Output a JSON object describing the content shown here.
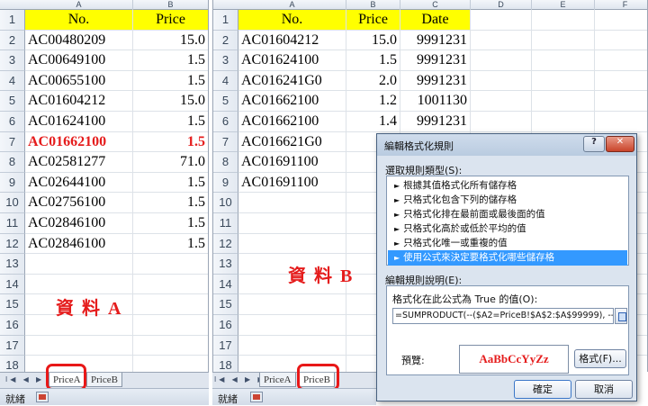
{
  "sheet_a": {
    "col_letters": [
      "A",
      "B",
      "C"
    ],
    "header": [
      "No.",
      "Price"
    ],
    "rows": [
      {
        "no": "AC00480209",
        "price": "15.0"
      },
      {
        "no": "AC00649100",
        "price": "1.5"
      },
      {
        "no": "AC00655100",
        "price": "1.5"
      },
      {
        "no": "AC01604212",
        "price": "15.0"
      },
      {
        "no": "AC01624100",
        "price": "1.5"
      },
      {
        "no": "AC01662100",
        "price": "1.5",
        "highlight": true
      },
      {
        "no": "AC02581277",
        "price": "71.0"
      },
      {
        "no": "AC02644100",
        "price": "1.5"
      },
      {
        "no": "AC02756100",
        "price": "1.5"
      },
      {
        "no": "AC02846100",
        "price": "1.5"
      },
      {
        "no": "AC02846100",
        "price": "1.5"
      }
    ],
    "caption": "資 料 A",
    "tabs": [
      "PriceA",
      "PriceB"
    ],
    "tab_nav": "I◀ ◀ ▶ ▶I",
    "status": "就緒"
  },
  "sheet_b": {
    "col_letters": [
      "A",
      "B",
      "C",
      "D",
      "E",
      "F"
    ],
    "header": [
      "No.",
      "Price",
      "Date"
    ],
    "rows": [
      {
        "no": "AC01604212",
        "price": "15.0",
        "date": "9991231"
      },
      {
        "no": "AC01624100",
        "price": "1.5",
        "date": "9991231"
      },
      {
        "no": "AC016241G0",
        "price": "2.0",
        "date": "9991231"
      },
      {
        "no": "AC01662100",
        "price": "1.2",
        "date": "1001130"
      },
      {
        "no": "AC01662100",
        "price": "1.4",
        "date": "9991231"
      },
      {
        "no": "AC016621G0",
        "price": "",
        "date": ""
      },
      {
        "no": "AC01691100",
        "price": "",
        "date": ""
      },
      {
        "no": "AC01691100",
        "price": "",
        "date": ""
      }
    ],
    "caption": "資 料 B",
    "tabs": [
      "PriceA",
      "PriceB"
    ],
    "tab_nav": "I◀ ◀ ▶ ▶I",
    "status": "就緒"
  },
  "row_numbers": [
    "1",
    "2",
    "3",
    "4",
    "5",
    "6",
    "7",
    "8",
    "9",
    "10",
    "11",
    "12",
    "13",
    "14",
    "15",
    "16",
    "17",
    "18"
  ],
  "dialog": {
    "title": "編輯格式化規則",
    "help_label": "?",
    "close_label": "✕",
    "rule_type_label": "選取規則類型(S):",
    "rule_types": [
      "根據其值格式化所有儲存格",
      "只格式化包含下列的儲存格",
      "只格式化排在最前面或最後面的值",
      "只格式化高於或低於平均的值",
      "只格式化唯一或重複的值",
      "使用公式來決定要格式化哪些儲存格"
    ],
    "selected_rule_index": 5,
    "desc_label": "編輯規則說明(E):",
    "formula_label": "格式化在此公式為 True 的值(O):",
    "formula": "=SUMPRODUCT(--($A2=PriceB!$A$2:$A$99999), --($B2<>",
    "preview_label": "預覽:",
    "preview_text": "AaBbCcYyZz",
    "format_button": "格式(F)...",
    "ok_button": "確定",
    "cancel_button": "取消"
  }
}
